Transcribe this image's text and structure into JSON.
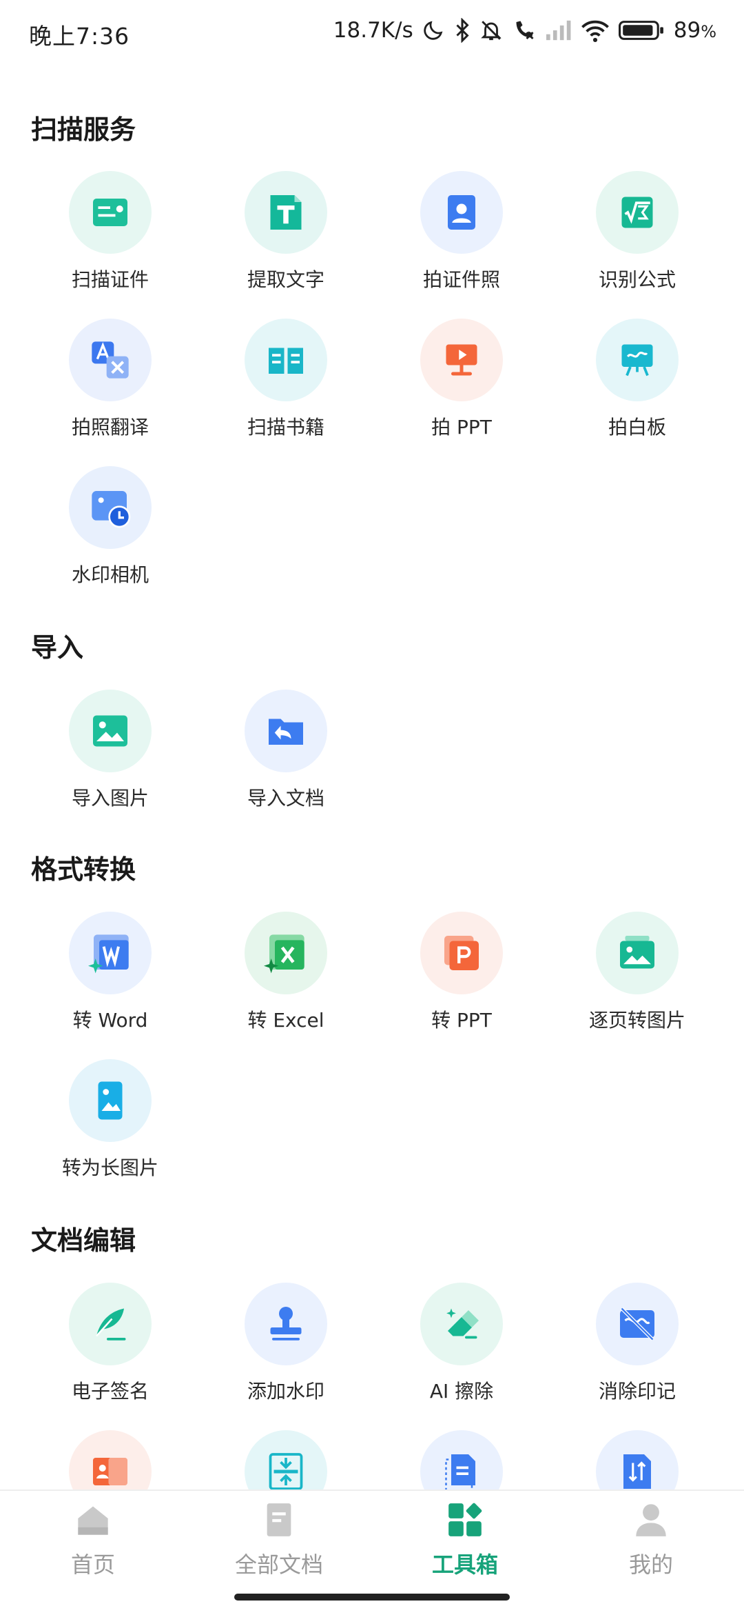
{
  "status_bar": {
    "time": "晚上7:36",
    "speed": "18.7K/s",
    "battery_percent": "89",
    "battery_suffix": "%"
  },
  "sections": {
    "scan": {
      "title": "扫描服务",
      "items": [
        {
          "label": "扫描证件",
          "icon": "id-card-icon",
          "color": "#1dbf9a",
          "bg": "#e6f7f2"
        },
        {
          "label": "提取文字",
          "icon": "text-t-icon",
          "color": "#14b89a",
          "bg": "#e4f6f3"
        },
        {
          "label": "拍证件照",
          "icon": "id-photo-icon",
          "color": "#3d7cf0",
          "bg": "#eaf1fe"
        },
        {
          "label": "识别公式",
          "icon": "formula-icon",
          "color": "#17b893",
          "bg": "#e6f7f1"
        },
        {
          "label": "拍照翻译",
          "icon": "translate-icon",
          "color": "#3c78ef",
          "bg": "#eaf0fd"
        },
        {
          "label": "扫描书籍",
          "icon": "book-icon",
          "color": "#19b6c8",
          "bg": "#e4f6f8"
        },
        {
          "label": "拍 PPT",
          "icon": "ppt-projector-icon",
          "color": "#f4663a",
          "bg": "#fdeeea"
        },
        {
          "label": "拍白板",
          "icon": "whiteboard-icon",
          "color": "#19b8cf",
          "bg": "#e4f6f9"
        },
        {
          "label": "水印相机",
          "icon": "watermark-camera-icon",
          "color": "#2f7ff2",
          "bg": "#e8f0fd"
        }
      ]
    },
    "import": {
      "title": "导入",
      "items": [
        {
          "label": "导入图片",
          "icon": "import-image-icon",
          "color": "#1dbf9a",
          "bg": "#e6f7f2"
        },
        {
          "label": "导入文档",
          "icon": "import-folder-icon",
          "color": "#3d7cf0",
          "bg": "#eaf1fe"
        }
      ]
    },
    "convert": {
      "title": "格式转换",
      "items": [
        {
          "label": "转 Word",
          "icon": "word-icon",
          "color": "#3d7cf0",
          "bg": "#eaf1fe"
        },
        {
          "label": "转 Excel",
          "icon": "excel-icon",
          "color": "#26b55e",
          "bg": "#e6f6ec"
        },
        {
          "label": "转 PPT",
          "icon": "ppt-icon",
          "color": "#f4663a",
          "bg": "#fdeeea"
        },
        {
          "label": "逐页转图片",
          "icon": "pages-to-image-icon",
          "color": "#17b893",
          "bg": "#e6f7f1"
        },
        {
          "label": "转为长图片",
          "icon": "long-image-icon",
          "color": "#19aee6",
          "bg": "#e4f4fb"
        }
      ]
    },
    "edit": {
      "title": "文档编辑",
      "items": [
        {
          "label": "电子签名",
          "icon": "signature-pen-icon",
          "color": "#17b893",
          "bg": "#e6f7f1"
        },
        {
          "label": "添加水印",
          "icon": "stamp-icon",
          "color": "#3d7cf0",
          "bg": "#eaf1fe"
        },
        {
          "label": "AI 擦除",
          "icon": "eraser-icon",
          "color": "#17b893",
          "bg": "#e6f7f1"
        },
        {
          "label": "消除印记",
          "icon": "remove-mark-icon",
          "color": "#3d7cf0",
          "bg": "#eaf1fe"
        },
        {
          "label": "",
          "icon": "id-compare-icon",
          "color": "#f4663a",
          "bg": "#fdeeea"
        },
        {
          "label": "",
          "icon": "compress-icon",
          "color": "#19b6c8",
          "bg": "#e4f6f8"
        },
        {
          "label": "",
          "icon": "doc-select-icon",
          "color": "#3d7cf0",
          "bg": "#eaf1fe"
        },
        {
          "label": "",
          "icon": "doc-sort-icon",
          "color": "#3d7cf0",
          "bg": "#eaf1fe"
        }
      ]
    }
  },
  "bottom_nav": {
    "items": [
      {
        "label": "首页",
        "icon": "home-icon"
      },
      {
        "label": "全部文档",
        "icon": "document-icon"
      },
      {
        "label": "工具箱",
        "icon": "toolbox-icon",
        "active": true
      },
      {
        "label": "我的",
        "icon": "person-icon"
      }
    ],
    "active_color": "#17a37a",
    "inactive_color": "#9a9a9a"
  }
}
